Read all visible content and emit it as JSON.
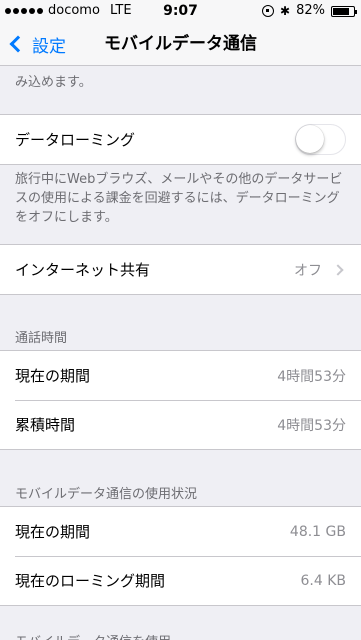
{
  "status_bar": {
    "carrier": "docomo",
    "network": "LTE",
    "time": "9:07",
    "battery": "82%",
    "battery_level": 0.82,
    "signal_bars": 5,
    "icons": [
      "orientation-lock-icon",
      "bluetooth-icon",
      "battery-icon"
    ]
  },
  "nav": {
    "back_label": "設定",
    "title": "モバイルデータ通信"
  },
  "top_cut_text": "み込めます。",
  "roaming": {
    "label": "データローミング",
    "enabled": false,
    "footer": "旅行中にWebブラウズ、メールやその他のデータサービスの使用による課金を回避するには、データローミングをオフにします。"
  },
  "tethering": {
    "label": "インターネット共有",
    "value": "オフ"
  },
  "call_time": {
    "header": "通話時間",
    "rows": [
      {
        "label": "現在の期間",
        "value": "4時間53分"
      },
      {
        "label": "累積時間",
        "value": "4時間53分"
      }
    ]
  },
  "usage": {
    "header": "モバイルデータ通信の使用状況",
    "rows": [
      {
        "label": "現在の期間",
        "value": "48.1 GB"
      },
      {
        "label": "現在のローミング期間",
        "value": "6.4 KB"
      }
    ]
  },
  "bottom_cut_text": "モバイルデータ通信を使用"
}
